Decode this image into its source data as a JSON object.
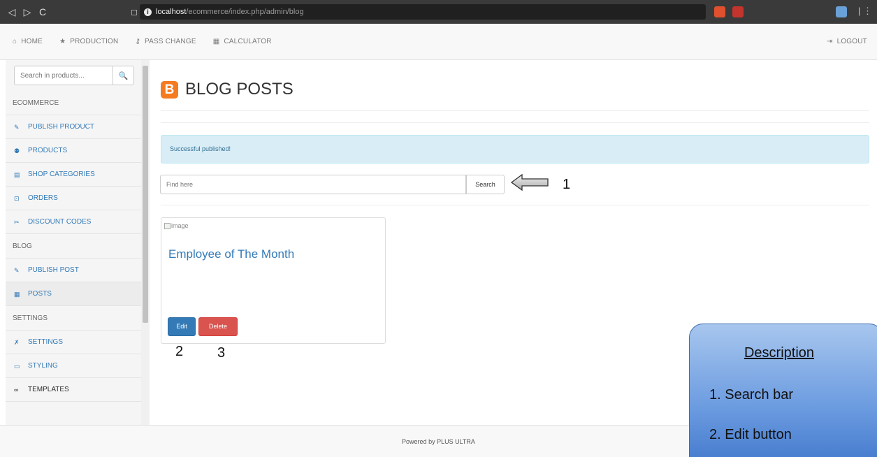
{
  "browser": {
    "back_glyph": "◁",
    "forward_glyph": "▷",
    "reload_glyph": "C",
    "bookmark_glyph": "◻",
    "info_glyph": "i",
    "url_host": "localhost",
    "url_path": "/ecommerce/index.php/admin/blog",
    "menu_glyph": "| ⋮"
  },
  "topnav": {
    "items": [
      {
        "icon": "home-icon",
        "glyph": "⌂",
        "label": "HOME"
      },
      {
        "icon": "star-icon",
        "glyph": "★",
        "label": "PRODUCTION"
      },
      {
        "icon": "key-icon",
        "glyph": "⚷",
        "label": "PASS CHANGE"
      },
      {
        "icon": "calculator-icon",
        "glyph": "▦",
        "label": "CALCULATOR"
      }
    ],
    "logout": {
      "icon": "logout-icon",
      "glyph": "⇥",
      "label": "LOGOUT"
    }
  },
  "sidebar": {
    "search_placeholder": "Search in products...",
    "search_glyph": "🔍",
    "sections": [
      {
        "heading": "ECOMMERCE",
        "items": [
          {
            "icon": "edit-icon",
            "glyph": "✎",
            "label": "PUBLISH PRODUCT"
          },
          {
            "icon": "products-icon",
            "glyph": "⚉",
            "label": "PRODUCTS"
          },
          {
            "icon": "list-icon",
            "glyph": "▤",
            "label": "SHOP CATEGORIES"
          },
          {
            "icon": "orders-icon",
            "glyph": "⊡",
            "label": "ORDERS"
          },
          {
            "icon": "tag-icon",
            "glyph": "✂",
            "label": "DISCOUNT CODES"
          }
        ]
      },
      {
        "heading": "BLOG",
        "items": [
          {
            "icon": "edit-icon",
            "glyph": "✎",
            "label": "PUBLISH POST"
          },
          {
            "icon": "grid-icon",
            "glyph": "▦",
            "label": "POSTS"
          }
        ]
      },
      {
        "heading": "SETTINGS",
        "items": [
          {
            "icon": "wrench-icon",
            "glyph": "✗",
            "label": "SETTINGS"
          },
          {
            "icon": "laptop-icon",
            "glyph": "▭",
            "label": "STYLING"
          },
          {
            "icon": "binoculars-icon",
            "glyph": "∞",
            "label": "TEMPLATES"
          }
        ]
      }
    ]
  },
  "main": {
    "title_icon_glyph": "B",
    "title": "BLOG POSTS",
    "alert": "Successful published!",
    "find_placeholder": "Find here",
    "find_button": "Search",
    "post": {
      "image_alt": "image",
      "title": "Employee of The Month",
      "edit_label": "Edit",
      "delete_label": "Delete"
    }
  },
  "annotations": {
    "num1": "1",
    "num2": "2",
    "num3": "3",
    "desc_title": "Description",
    "desc_items": [
      "1. Search bar",
      "2. Edit button"
    ]
  },
  "footer": {
    "text": "Powered by PLUS ULTRA"
  }
}
